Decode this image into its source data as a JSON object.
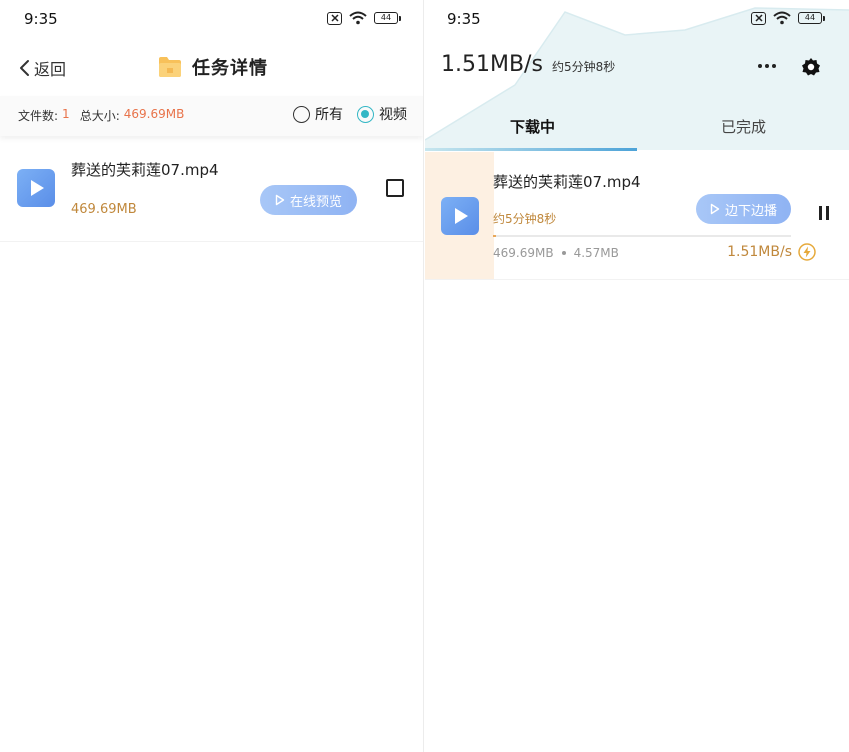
{
  "left": {
    "status": {
      "time": "9:35",
      "battery": "44"
    },
    "nav": {
      "back_label": "返回",
      "title": "任务详情"
    },
    "summary": {
      "file_count_label": "文件数:",
      "file_count": "1",
      "total_size_label": "总大小:",
      "total_size": "469.69MB"
    },
    "filters": {
      "all_label": "所有",
      "video_label": "视频",
      "selected": "视频"
    },
    "files": [
      {
        "name": "葬送的芙莉莲07.mp4",
        "size": "469.69MB",
        "preview_label": "在线预览",
        "checked": false
      }
    ]
  },
  "right": {
    "status": {
      "time": "9:35",
      "battery": "44"
    },
    "header": {
      "speed": "1.51MB/s",
      "eta": "约5分钟8秒"
    },
    "tabs": [
      {
        "label": "下载中",
        "active": true
      },
      {
        "label": "已完成",
        "active": false
      }
    ],
    "tasks": [
      {
        "name": "葬送的芙莉莲07.mp4",
        "eta": "约5分钟8秒",
        "play_label": "边下边播",
        "total_size": "469.69MB",
        "downloaded": "4.57MB",
        "speed": "1.51MB/s",
        "progress_fraction": 0.0097
      }
    ]
  },
  "colors": {
    "accent_orange": "#e8734a",
    "size_brown": "#c0883c",
    "radio_teal": "#34b7c5",
    "button_blue": "#8fb3f3",
    "header_tint": "#e9f4f6"
  }
}
